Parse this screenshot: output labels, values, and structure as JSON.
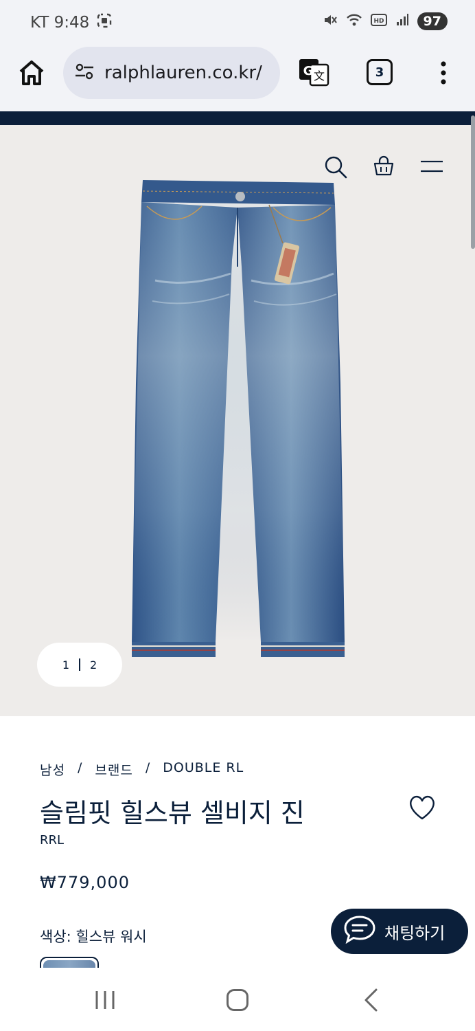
{
  "status": {
    "carrier_time": "KT 9:48",
    "battery": "97"
  },
  "browser": {
    "url": "ralphlauren.co.kr/",
    "tab_count": "3"
  },
  "gallery": {
    "current": "1",
    "total": "2"
  },
  "breadcrumb": {
    "items": [
      "남성",
      "브랜드",
      "DOUBLE RL"
    ],
    "separator": "/"
  },
  "product": {
    "title": "슬림핏 힐스뷰 셀비지 진",
    "brand": "RRL",
    "price": "₩779,000",
    "color_label": "색상: 힐스뷰 워시"
  },
  "chat": {
    "label": "채팅하기"
  },
  "colors": {
    "navy": "#0b1f3a",
    "hero_bg": "#eeecea"
  }
}
